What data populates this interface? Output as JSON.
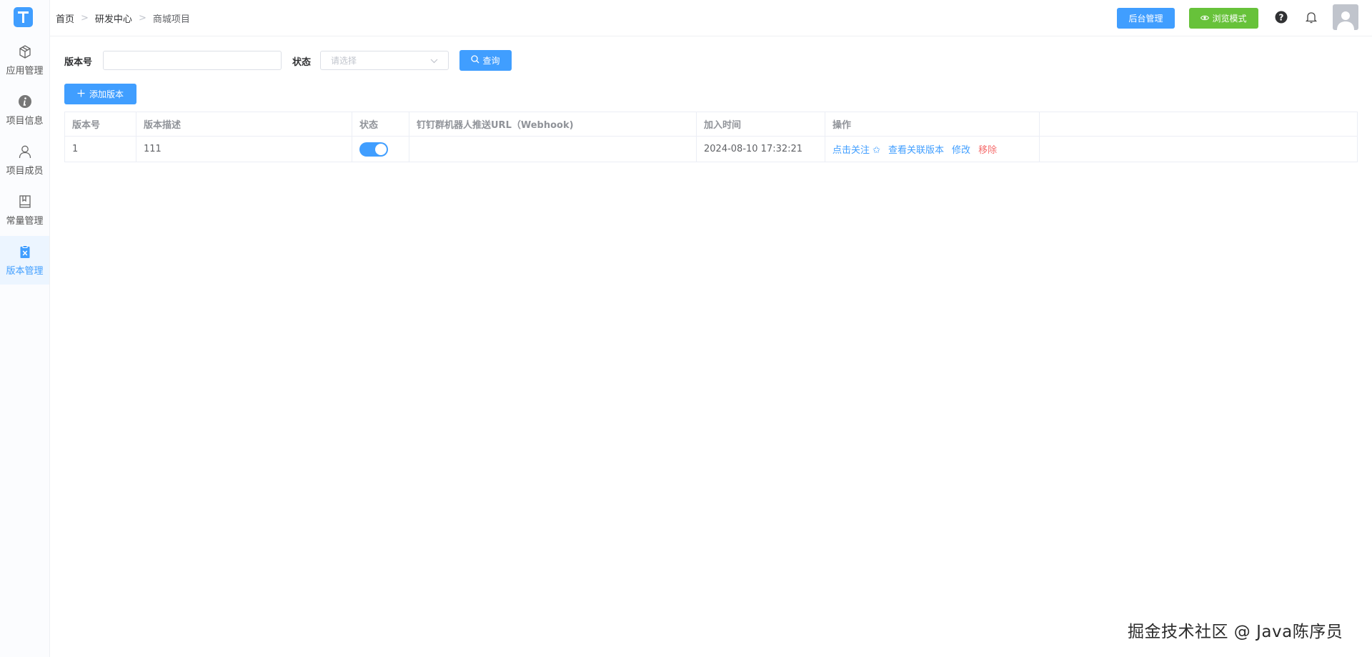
{
  "sidebar": {
    "items": [
      {
        "label": "应用管理",
        "icon": "box-icon"
      },
      {
        "label": "项目信息",
        "icon": "info-icon"
      },
      {
        "label": "项目成员",
        "icon": "user-icon"
      },
      {
        "label": "常量管理",
        "icon": "book-icon"
      },
      {
        "label": "版本管理",
        "icon": "clipboard-icon",
        "active": true
      }
    ]
  },
  "header": {
    "breadcrumb": [
      "首页",
      "研发中心",
      "商城项目"
    ],
    "admin_label": "后台管理",
    "browse_label": "浏览模式"
  },
  "filter": {
    "version_label": "版本号",
    "version_value": "",
    "status_label": "状态",
    "status_placeholder": "请选择",
    "query_label": "查询"
  },
  "add_label": "添加版本",
  "table": {
    "headers": [
      "版本号",
      "版本描述",
      "状态",
      "钉钉群机器人推送URL（Webhook)",
      "加入时间",
      "操作"
    ],
    "rows": [
      {
        "version": "1",
        "desc": "111",
        "status": true,
        "webhook": "",
        "time": "2024-08-10 17:32:21",
        "ops": {
          "follow": "点击关注 ✩",
          "related": "查看关联版本",
          "edit": "修改",
          "remove": "移除"
        }
      }
    ]
  },
  "watermark": "掘金技术社区 @ Java陈序员",
  "colors": {
    "primary": "#409eff",
    "success": "#67c23a",
    "danger": "#f56c6c"
  }
}
